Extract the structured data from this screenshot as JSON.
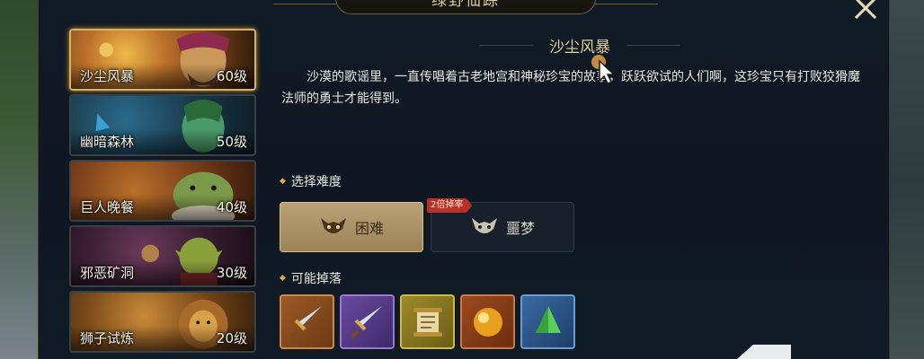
{
  "window": {
    "title": "绿野仙踪"
  },
  "dungeons": [
    {
      "name": "沙尘风暴",
      "level": "60级"
    },
    {
      "name": "幽暗森林",
      "level": "50级"
    },
    {
      "name": "巨人晚餐",
      "level": "40级"
    },
    {
      "name": "邪恶矿洞",
      "level": "30级"
    },
    {
      "name": "狮子试炼",
      "level": "20级"
    }
  ],
  "detail": {
    "heading": "沙尘风暴",
    "description": "沙漠的歌谣里，一直传唱着古老地宫和神秘珍宝的故事，跃跃欲试的人们啊，这珍宝只有打败狡猾魔法师的勇士才能得到。",
    "difficulty_label": "选择难度",
    "difficulties": [
      {
        "label": "困难"
      },
      {
        "label": "噩梦",
        "badge": "2倍掉率"
      }
    ],
    "drops_label": "可能掉落",
    "drops": [
      {
        "icon": "sword-icon",
        "rarity": "orange"
      },
      {
        "icon": "sword-icon",
        "rarity": "purple"
      },
      {
        "icon": "scroll-icon",
        "rarity": "gold"
      },
      {
        "icon": "golden-orb-icon",
        "rarity": "orange"
      },
      {
        "icon": "green-crystal-icon",
        "rarity": "blue"
      }
    ]
  },
  "colors": {
    "accent_gold": "#d9b35a",
    "selected_difficulty": "#b9a076",
    "badge_red": "#b9302a"
  }
}
